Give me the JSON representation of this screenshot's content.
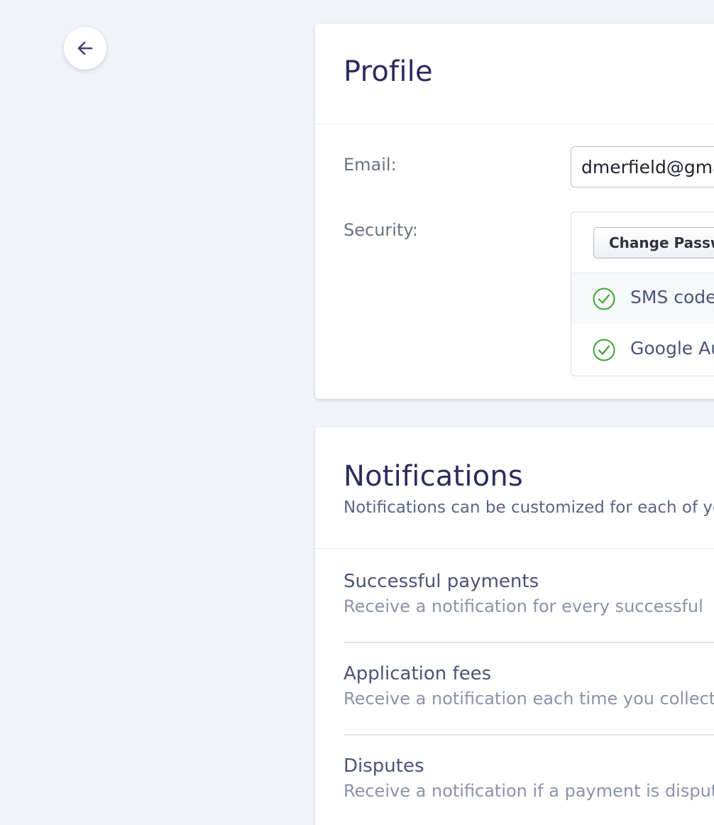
{
  "back_button": {
    "icon": "arrow-left-icon"
  },
  "profile": {
    "title": "Profile",
    "email_label": "Email:",
    "email_value": "dmerfield@gmail.com",
    "security_label": "Security:",
    "change_password_label": "Change Password",
    "security_methods": [
      {
        "label": "SMS code",
        "status": "enabled",
        "icon": "check-circle-icon"
      },
      {
        "label": "Google Authenticator",
        "status": "enabled",
        "icon": "check-circle-icon"
      }
    ]
  },
  "notifications": {
    "title": "Notifications",
    "subtitle": "Notifications can be customized for each of your",
    "items": [
      {
        "title": "Successful payments",
        "description": "Receive a notification for every successful"
      },
      {
        "title": "Application fees",
        "description": "Receive a notification each time you collect"
      },
      {
        "title": "Disputes",
        "description": "Receive a notification if a payment is disputed"
      }
    ]
  },
  "colors": {
    "background": "#f0f3f8",
    "heading": "#2b2d5e",
    "check_green": "#3fa535"
  }
}
